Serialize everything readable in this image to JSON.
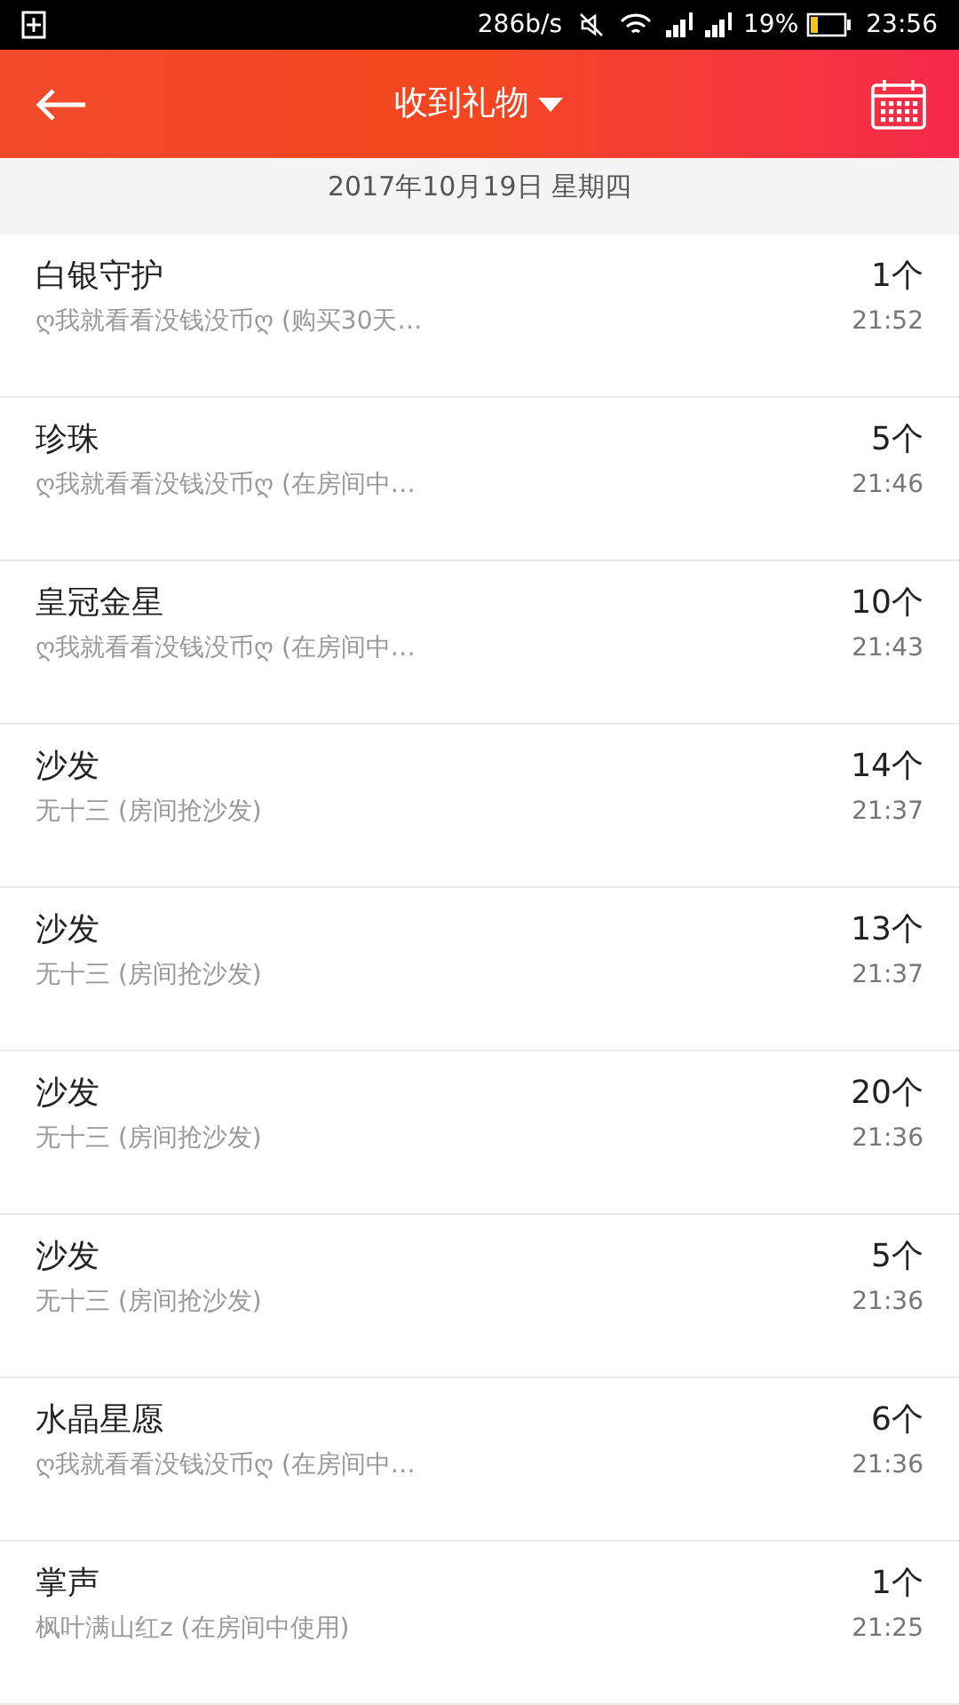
{
  "status_bar": {
    "speed": "286b/s",
    "battery": "19%",
    "time": "23:56"
  },
  "header": {
    "title": "收到礼物"
  },
  "date": "2017年10月19日 星期四",
  "rows": [
    {
      "name": "白银守护",
      "detail": "ღ我就看看没钱没币ღ (购买30天…",
      "count": "1个",
      "time": "21:52"
    },
    {
      "name": "珍珠",
      "detail": "ღ我就看看没钱没币ღ (在房间中…",
      "count": "5个",
      "time": "21:46"
    },
    {
      "name": "皇冠金星",
      "detail": "ღ我就看看没钱没币ღ (在房间中…",
      "count": "10个",
      "time": "21:43"
    },
    {
      "name": "沙发",
      "detail": "无十三 (房间抢沙发)",
      "count": "14个",
      "time": "21:37"
    },
    {
      "name": "沙发",
      "detail": "无十三 (房间抢沙发)",
      "count": "13个",
      "time": "21:37"
    },
    {
      "name": "沙发",
      "detail": "无十三 (房间抢沙发)",
      "count": "20个",
      "time": "21:36"
    },
    {
      "name": "沙发",
      "detail": "无十三 (房间抢沙发)",
      "count": "5个",
      "time": "21:36"
    },
    {
      "name": "水晶星愿",
      "detail": "ღ我就看看没钱没币ღ (在房间中…",
      "count": "6个",
      "time": "21:36"
    },
    {
      "name": "掌声",
      "detail": "枫叶满山红z (在房间中使用)",
      "count": "1个",
      "time": "21:25"
    }
  ]
}
